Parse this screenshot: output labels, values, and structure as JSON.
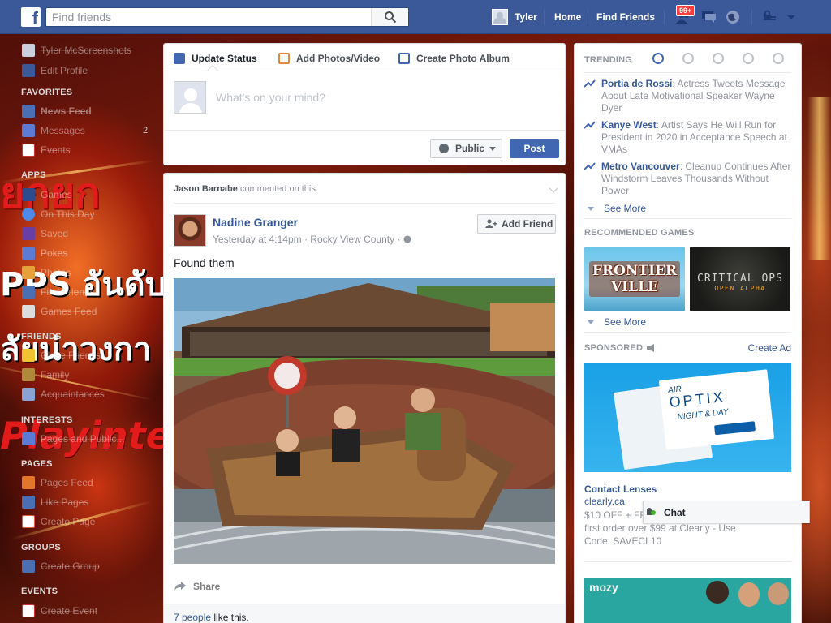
{
  "topbar": {
    "logo": "f",
    "search_placeholder": "Find friends",
    "user_name": "Tyler",
    "home_label": "Home",
    "find_friends_label": "Find Friends",
    "notification_count": "99+",
    "brand_color": "#3b5998"
  },
  "leftnav": {
    "profile_name": "Tyler McScreenshots",
    "edit_profile": "Edit Profile",
    "favorites_head": "FAVORITES",
    "news_feed": "News Feed",
    "messages": "Messages",
    "messages_count": "2",
    "events": "Events",
    "apps_head": "APPS",
    "games": "Games",
    "on_this_day": "On This Day",
    "saved": "Saved",
    "pokes": "Pokes",
    "photos": "Photos",
    "find_friends": "Find Friends",
    "games_feed": "Games Feed",
    "friends_head": "FRIENDS",
    "close_friends": "Close Friends",
    "family": "Family",
    "acquaintances": "Acquaintances",
    "interests_head": "INTERESTS",
    "pages_public": "Pages and Public...",
    "pages_head": "PAGES",
    "pages_feed": "Pages Feed",
    "like_pages": "Like Pages",
    "create_page": "Create Page",
    "groups_head": "GROUPS",
    "create_group": "Create Group",
    "events_head": "EVENTS",
    "create_event": "Create Event"
  },
  "background_text": {
    "line1": "PPS อันดับ",
    "line2": "ลัยน่าวงกา",
    "line3": "Playinte"
  },
  "composer": {
    "tab_status": "Update Status",
    "tab_photos": "Add Photos/Video",
    "tab_album": "Create Photo Album",
    "placeholder": "What's on your mind?",
    "privacy": "Public",
    "post_label": "Post"
  },
  "post": {
    "story_actor": "Jason Barnabe",
    "story_action": "commented on this.",
    "author": "Nadine Granger",
    "meta": "Yesterday at 4:14pm · Rocky View County ·",
    "add_friend": "Add Friend",
    "text": "Found them",
    "share": "Share",
    "likes_link": "7 people",
    "likes_rest": "like this."
  },
  "rightcol": {
    "trending_head": "TRENDING",
    "trends": [
      {
        "name": "Portia de Rossi",
        "text": ": Actress Tweets Message About Late Motivational Speaker Wayne Dyer"
      },
      {
        "name": "Kanye West",
        "text": ": Artist Says He Will Run for President in 2020 in Acceptance Speech at VMAs"
      },
      {
        "name": "Metro Vancouver",
        "text": ": Cleanup Continues After Windstorm Leaves Thousands Without Power"
      }
    ],
    "see_more": "See More",
    "games_head": "RECOMMENDED GAMES",
    "game1": "FRONTIER VILLE",
    "game2_title": "CRITICAL OPS",
    "game2_sub": "OPEN ALPHA",
    "sponsored_head": "SPONSORED",
    "create_ad": "Create Ad",
    "ad_brand_top": "AIR",
    "ad_brand": "OPTIX",
    "ad_sub": "NIGHT & DAY",
    "ad_title": "Contact Lenses",
    "ad_url": "clearly.ca",
    "ad_desc": "$10 OFF + FREE SHIPPING on your first order over $99 at Clearly - Use Code: SAVECL10",
    "ad2_brand": "mozy"
  },
  "chat": {
    "label": "Chat"
  }
}
